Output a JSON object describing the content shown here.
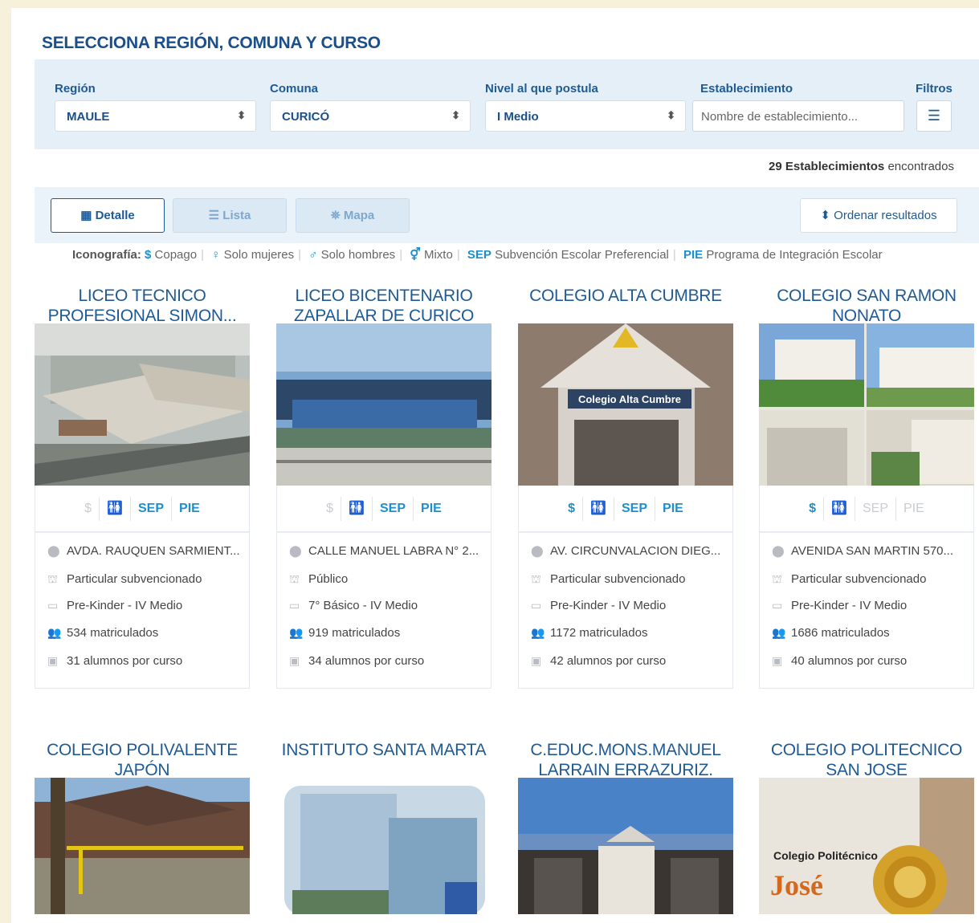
{
  "title": "SELECCIONA REGIÓN, COMUNA Y CURSO",
  "filters": {
    "region_label": "Región",
    "region_value": "MAULE",
    "comuna_label": "Comuna",
    "comuna_value": "CURICÓ",
    "nivel_label": "Nivel al que postula",
    "nivel_value": "I Medio",
    "establecimiento_label": "Establecimiento",
    "establecimiento_placeholder": "Nombre de establecimiento...",
    "filtros_label": "Filtros"
  },
  "results": {
    "count": "29",
    "count_strong": "Establecimientos",
    "count_suffix": "encontrados"
  },
  "views": {
    "detalle": "Detalle",
    "lista": "Lista",
    "mapa": "Mapa",
    "order": "Ordenar resultados"
  },
  "legend": {
    "label": "Iconografía:",
    "copago": "Copago",
    "mujeres": "Solo mujeres",
    "hombres": "Solo hombres",
    "mixto": "Mixto",
    "sep_abbr": "SEP",
    "sep": "Subvención Escolar Preferencial",
    "pie_abbr": "PIE",
    "pie": "Programa de Integración Escolar"
  },
  "schools": [
    {
      "name1": "LICEO TECNICO",
      "name2": "PROFESIONAL SIMON...",
      "address": "AVDA. RAUQUEN SARMIENT...",
      "type": "Particular subvencionado",
      "levels": "Pre-Kinder - IV Medio",
      "enrolled": "534 matriculados",
      "per_course": "31 alumnos por curso"
    },
    {
      "name1": "LICEO BICENTENARIO",
      "name2": "ZAPALLAR DE CURICO",
      "address": "CALLE MANUEL LABRA N° 2...",
      "type": "Público",
      "levels": "7° Básico - IV Medio",
      "enrolled": "919 matriculados",
      "per_course": "34 alumnos por curso"
    },
    {
      "name1": "COLEGIO ALTA CUMBRE",
      "name2": "",
      "address": "AV. CIRCUNVALACION DIEG...",
      "type": "Particular subvencionado",
      "levels": "Pre-Kinder - IV Medio",
      "enrolled": "1172 matriculados",
      "per_course": "42 alumnos por curso"
    },
    {
      "name1": "COLEGIO SAN RAMON",
      "name2": "NONATO",
      "address": "AVENIDA SAN MARTIN 570...",
      "type": "Particular subvencionado",
      "levels": "Pre-Kinder - IV Medio",
      "enrolled": "1686 matriculados",
      "per_course": "40 alumnos por curso"
    },
    {
      "name1": "COLEGIO POLIVALENTE",
      "name2": "JAPÓN"
    },
    {
      "name1": "INSTITUTO SANTA MARTA",
      "name2": ""
    },
    {
      "name1": "C.EDUC.MONS.MANUEL",
      "name2": "LARRAIN ERRAZURIZ."
    },
    {
      "name1": "COLEGIO POLITECNICO",
      "name2": "SAN JOSE"
    }
  ],
  "image_texts": {
    "alta_cumbre_sign": "Colegio Alta Cumbre",
    "politecnico_logo": "Colegio Politécnico",
    "politecnico_jose": "José"
  },
  "badges": {
    "copago": "$",
    "mixto": "🚻",
    "sep": "SEP",
    "pie": "PIE"
  }
}
